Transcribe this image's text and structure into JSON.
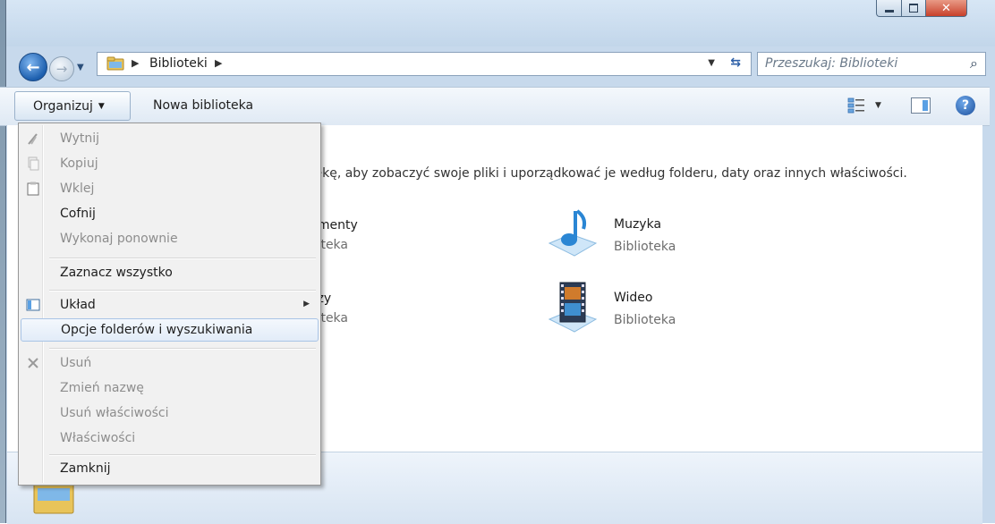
{
  "nav": {
    "breadcrumb_root": "Biblioteki",
    "search_placeholder": "Przeszukaj: Biblioteki"
  },
  "toolbar": {
    "organize_label": "Organizuj",
    "new_library_label": "Nowa biblioteka"
  },
  "content": {
    "info_text": "tekę, aby zobaczyć swoje pliki i uporządkować je według folderu, daty oraz innych właściwości.",
    "libraries": [
      {
        "name": "umenty",
        "type": "ioteka"
      },
      {
        "name": "Muzyka",
        "type": "Biblioteka"
      },
      {
        "name": "azy",
        "type": "ioteka"
      },
      {
        "name": "Wideo",
        "type": "Biblioteka"
      }
    ]
  },
  "menu": {
    "items": [
      {
        "label": "Wytnij",
        "enabled": false,
        "icon": "scissors-icon"
      },
      {
        "label": "Kopiuj",
        "enabled": false,
        "icon": "copy-icon"
      },
      {
        "label": "Wklej",
        "enabled": false,
        "icon": "paste-icon"
      },
      {
        "label": "Cofnij",
        "enabled": true
      },
      {
        "label": "Wykonaj ponownie",
        "enabled": false
      },
      {
        "label": "Zaznacz wszystko",
        "enabled": true
      },
      {
        "label": "Układ",
        "enabled": true,
        "icon": "layout-icon",
        "submenu": true
      },
      {
        "label": "Opcje folderów i wyszukiwania",
        "enabled": true,
        "highlighted": true
      },
      {
        "label": "Usuń",
        "enabled": false,
        "icon": "delete-icon"
      },
      {
        "label": "Zmień nazwę",
        "enabled": false
      },
      {
        "label": "Usuń właściwości",
        "enabled": false
      },
      {
        "label": "Właściwości",
        "enabled": false
      },
      {
        "label": "Zamknij",
        "enabled": true
      }
    ]
  },
  "colors": {
    "accent": "#1d5fae",
    "close_button": "#c8412b",
    "window_frame": "#c7d9ec"
  }
}
